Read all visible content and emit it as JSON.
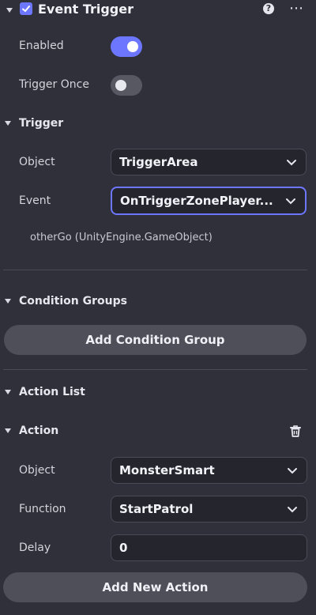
{
  "header": {
    "title": "Event Trigger",
    "enabled_checkbox": true
  },
  "fields": {
    "enabled_label": "Enabled",
    "enabled_value": true,
    "trigger_once_label": "Trigger Once",
    "trigger_once_value": false
  },
  "trigger": {
    "title": "Trigger",
    "object_label": "Object",
    "object_value": "TriggerArea",
    "event_label": "Event",
    "event_value": "OnTriggerZonePlayer...",
    "param_text": "otherGo (UnityEngine.GameObject)"
  },
  "conditions": {
    "title": "Condition Groups",
    "add_button": "Add Condition Group"
  },
  "action_list": {
    "title": "Action List",
    "action": {
      "title": "Action",
      "object_label": "Object",
      "object_value": "MonsterSmart",
      "function_label": "Function",
      "function_value": "StartPatrol",
      "delay_label": "Delay",
      "delay_value": "0"
    },
    "add_button": "Add New Action"
  },
  "colors": {
    "accent": "#6d76ff",
    "panel": "#2f3039",
    "field": "#25262d"
  }
}
